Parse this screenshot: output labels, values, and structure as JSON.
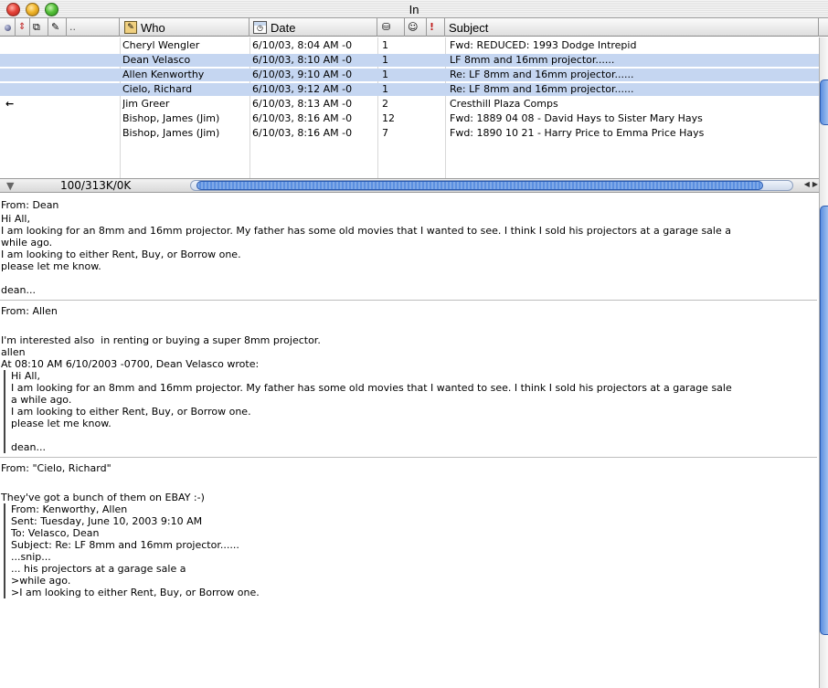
{
  "window": {
    "title": "In"
  },
  "columns": {
    "who": "Who",
    "date": "Date",
    "subject": "Subject",
    "icons": [
      "status-icon",
      "priority-icon",
      "attachment-icon",
      "label-icon",
      "who-icon",
      "date-icon",
      "size-icon",
      "mood-icon",
      "flag-icon"
    ]
  },
  "messages": [
    {
      "status": "",
      "who": "Cheryl Wengler",
      "date": "6/10/03, 8:04 AM -0",
      "size": "1",
      "subject": "Fwd: REDUCED: 1993 Dodge Intrepid",
      "selected": false
    },
    {
      "status": "dot",
      "who": "Dean Velasco",
      "date": "6/10/03, 8:10 AM -0",
      "size": "1",
      "subject": "LF 8mm and 16mm projector......",
      "selected": true
    },
    {
      "status": "dot",
      "who": "Allen Kenworthy",
      "date": "6/10/03, 9:10 AM -0",
      "size": "1",
      "subject": "Re: LF 8mm and 16mm projector......",
      "selected": true
    },
    {
      "status": "dot",
      "who": "Cielo, Richard",
      "date": "6/10/03, 9:12 AM -0",
      "size": "1",
      "subject": "Re: LF 8mm and 16mm projector......",
      "selected": true
    },
    {
      "status": "←",
      "who": "Jim Greer",
      "date": "6/10/03, 8:13 AM -0",
      "size": "2",
      "subject": "Cresthill Plaza Comps",
      "selected": false
    },
    {
      "status": "",
      "who": "Bishop, James (Jim)",
      "date": "6/10/03, 8:16 AM -0",
      "size": "12",
      "subject": "Fwd: 1889 04 08 - David Hays to Sister Mary Hays",
      "selected": false
    },
    {
      "status": "dot",
      "who": "Bishop, James (Jim)",
      "date": "6/10/03, 8:16 AM -0",
      "size": "7",
      "subject": "Fwd: 1890 10 21 - Harry Price to Emma Price Hays",
      "selected": false
    }
  ],
  "status_bar": {
    "text": "100/313K/0K"
  },
  "preview": {
    "msg1": {
      "from": "From: Dean",
      "lines": [
        "Hi All,",
        "I am looking for an 8mm and 16mm projector. My father has some old movies that I wanted to see. I think I sold his projectors at a garage sale a",
        "while ago.",
        "I am looking to either Rent, Buy, or Borrow one.",
        "please let me know.",
        "",
        "dean..."
      ]
    },
    "msg2": {
      "from": "From: Allen",
      "lines": [
        "",
        "I'm interested also  in renting or buying a super 8mm projector.",
        "allen",
        "At 08:10 AM 6/10/2003 -0700, Dean Velasco wrote:"
      ],
      "quote": [
        "Hi All,",
        "I am looking for an 8mm and 16mm projector. My father has some old movies that I wanted to see. I think I sold his projectors at a garage sale",
        "a while ago.",
        "I am looking to either Rent, Buy, or Borrow one.",
        "please let me know.",
        "",
        "dean..."
      ]
    },
    "msg3": {
      "from": "From: \"Cielo, Richard\"",
      "lines": [
        "",
        "They've got a bunch of them on EBAY :-)"
      ],
      "quote": [
        "From: Kenworthy, Allen",
        "Sent: Tuesday, June 10, 2003 9:10 AM",
        "To: Velasco, Dean",
        "Subject: Re: LF 8mm and 16mm projector......",
        "...snip...",
        "... his projectors at a garage sale a",
        ">while ago.",
        ">I am looking to either Rent, Buy, or Borrow one."
      ]
    }
  }
}
